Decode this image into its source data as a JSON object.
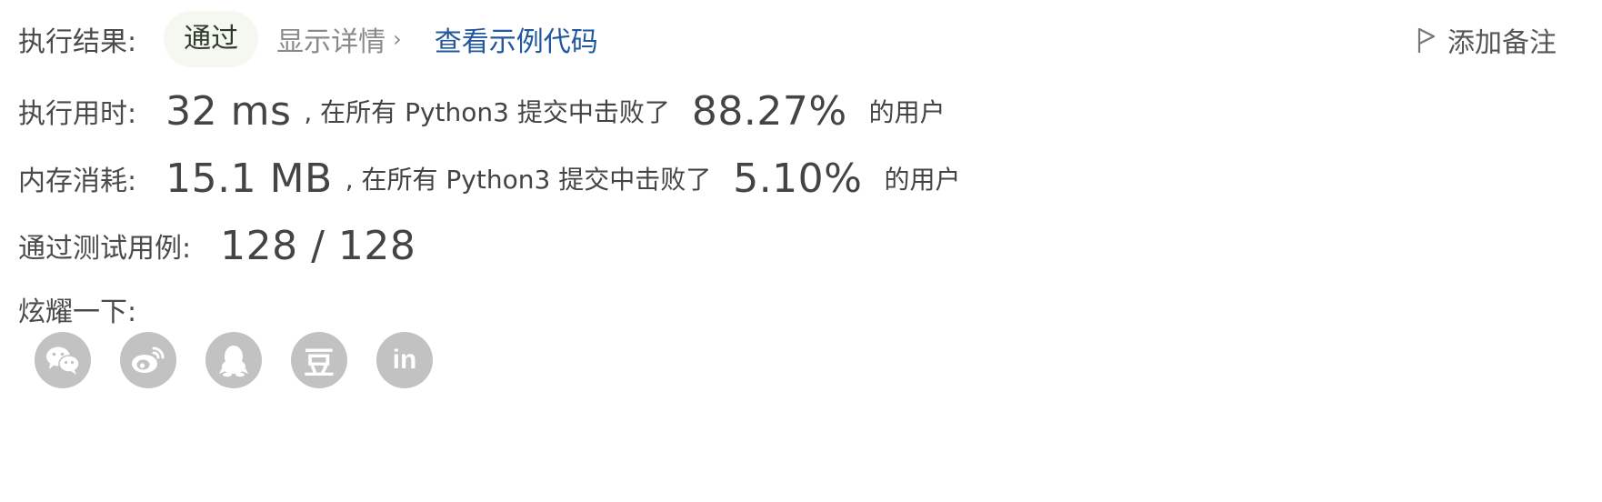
{
  "result": {
    "label": "执行结果:",
    "status": "通过",
    "details": "显示详情",
    "example_code": "查看示例代码"
  },
  "add_note": "添加备注",
  "runtime": {
    "label": "执行用时:",
    "value": "32 ms",
    "mid_text": ", 在所有 Python3 提交中击败了",
    "percent": "88.27%",
    "suffix": "的用户"
  },
  "memory": {
    "label": "内存消耗:",
    "value": "15.1 MB",
    "mid_text": ", 在所有 Python3 提交中击败了",
    "percent": "5.10%",
    "suffix": "的用户"
  },
  "tests": {
    "label": "通过测试用例:",
    "value": "128 / 128"
  },
  "show_off": "炫耀一下:",
  "share": {
    "icons": [
      "wechat-icon",
      "weibo-icon",
      "qq-icon",
      "douban-icon",
      "linkedin-icon"
    ],
    "douban_glyph": "豆",
    "linkedin_glyph": "in"
  },
  "colors": {
    "link": "#21579c",
    "pill_bg": "#f4f8f1",
    "icon_bg": "#c2c2c2"
  }
}
